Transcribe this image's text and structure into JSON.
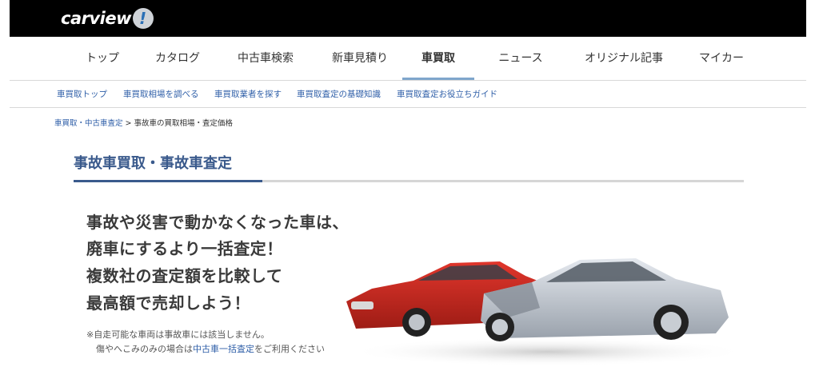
{
  "header": {
    "logo_text": "carview",
    "logo_mark": "exclamation-badge-icon"
  },
  "gnav": {
    "items": [
      {
        "label": "トップ"
      },
      {
        "label": "カタログ"
      },
      {
        "label": "中古車検索"
      },
      {
        "label": "新車見積り"
      },
      {
        "label": "車買取",
        "active": true
      },
      {
        "label": "ニュース"
      },
      {
        "label": "オリジナル記事"
      },
      {
        "label": "マイカー"
      }
    ]
  },
  "subnav": {
    "items": [
      {
        "label": "車買取トップ"
      },
      {
        "label": "車買取相場を調べる"
      },
      {
        "label": "車買取業者を探す"
      },
      {
        "label": "車買取査定の基礎知識"
      },
      {
        "label": "車買取査定お役立ちガイド"
      }
    ]
  },
  "breadcrumb": {
    "link": "車買取・中古車査定",
    "separator": ">",
    "current": "事故車の買取相場・査定価格"
  },
  "page": {
    "title": "事故車買取・事故車査定"
  },
  "hero": {
    "lines": [
      "事故や災害で動かなくなった車は、",
      "廃車にするより一括査定！",
      "複数社の査定額を比較して",
      "最高額で売却しよう！"
    ],
    "note_line1": "※自走可能な車両は事故車には該当しません。",
    "note_line2_prefix": "傷やへこみのみの場合は",
    "note_line2_link": "中古車一括査定",
    "note_line2_suffix": "をご利用ください",
    "image": "crashed-cars-image"
  },
  "colors": {
    "accent": "#3a5a8c",
    "link": "#2f5fa8",
    "topbar": "#000000",
    "active_underline": "#7fa6cc"
  }
}
